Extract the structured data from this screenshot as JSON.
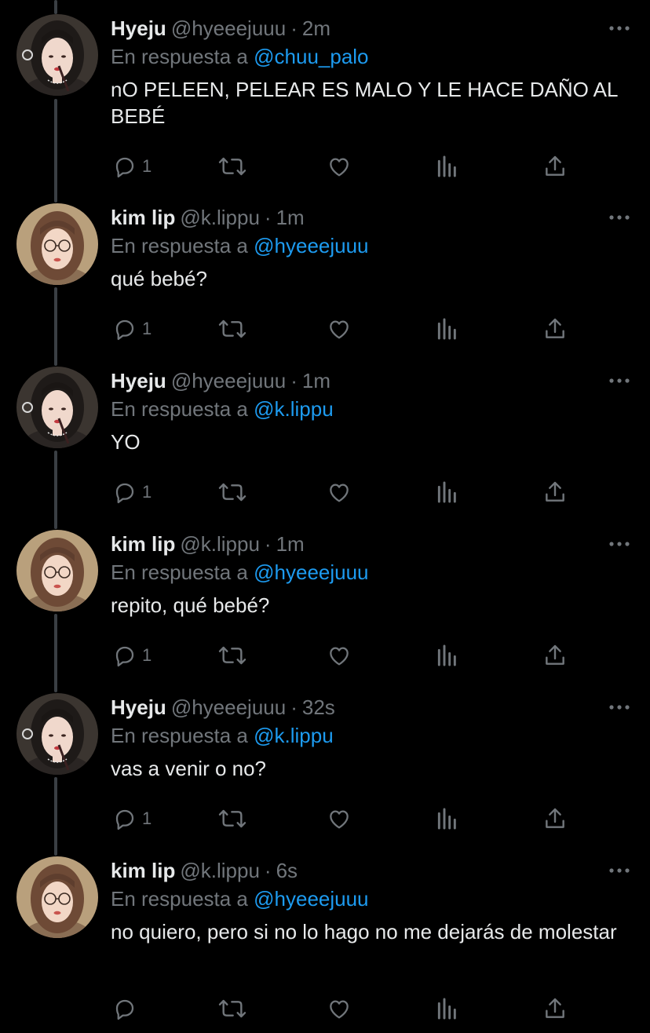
{
  "colors": {
    "background": "#000000",
    "text": "#e7e9ea",
    "muted": "#71767b",
    "mention": "#1d9bf0",
    "thread_line": "#3a3f44"
  },
  "reply_prefix": "En respuesta a",
  "tweets": [
    {
      "name": "Hyeju",
      "handle": "@hyeeejuuu",
      "separator": "·",
      "time": "2m",
      "reply_to": "@chuu_palo",
      "text": "nO PELEEN, PELEAR ES MALO Y LE HACE DAÑO AL BEBÉ",
      "reply_count": "1",
      "avatar_icon": "hyeju-avatar"
    },
    {
      "name": "kim lip",
      "handle": "@k.lippu",
      "separator": "·",
      "time": "1m",
      "reply_to": "@hyeeejuuu",
      "text": "qué bebé?",
      "reply_count": "1",
      "avatar_icon": "kimlip-avatar"
    },
    {
      "name": "Hyeju",
      "handle": "@hyeeejuuu",
      "separator": "·",
      "time": "1m",
      "reply_to": "@k.lippu",
      "text": "YO",
      "reply_count": "1",
      "avatar_icon": "hyeju-avatar"
    },
    {
      "name": "kim lip",
      "handle": "@k.lippu",
      "separator": "·",
      "time": "1m",
      "reply_to": "@hyeeejuuu",
      "text": "repito, qué bebé?",
      "reply_count": "1",
      "avatar_icon": "kimlip-avatar"
    },
    {
      "name": "Hyeju",
      "handle": "@hyeeejuuu",
      "separator": "·",
      "time": "32s",
      "reply_to": "@k.lippu",
      "text": "vas a venir o no?",
      "reply_count": "1",
      "avatar_icon": "hyeju-avatar"
    },
    {
      "name": "kim lip",
      "handle": "@k.lippu",
      "separator": "·",
      "time": "6s",
      "reply_to": "@hyeeejuuu",
      "text": "no quiero, pero si no lo hago no me dejarás de molestar",
      "reply_count": "",
      "avatar_icon": "kimlip-avatar"
    }
  ],
  "action_icons": [
    "reply-icon",
    "retweet-icon",
    "like-icon",
    "analytics-icon",
    "share-icon"
  ],
  "more_icon": "more-options-icon"
}
